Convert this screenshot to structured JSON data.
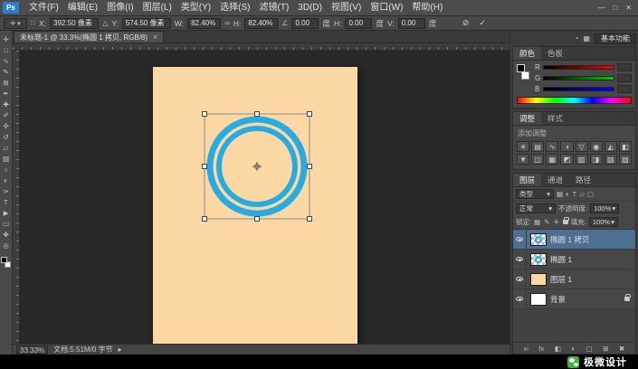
{
  "ui": {
    "caret": "▾"
  },
  "titlebar": {
    "logo": "Ps",
    "menus": [
      "文件(F)",
      "编辑(E)",
      "图像(I)",
      "图层(L)",
      "类型(Y)",
      "选择(S)",
      "滤镜(T)",
      "3D(D)",
      "视图(V)",
      "窗口(W)",
      "帮助(H)"
    ],
    "window_controls": {
      "minimize": "—",
      "restore": "□",
      "close": "✕"
    }
  },
  "options": {
    "preset_glyph": "✛",
    "ref_glyph": "∷",
    "x_label": "X:",
    "x_value": "392.50 像素",
    "delta_glyph": "△",
    "y_label": "Y:",
    "y_value": "574.50 像素",
    "w_label": "W:",
    "w_value": "82.40%",
    "link_glyph": "∞",
    "h_label": "H:",
    "h_value": "82.40%",
    "angle_glyph": "∠",
    "angle_value": "0.00",
    "deg_unit": "度",
    "hskew_label": "H:",
    "hskew_value": "0.00",
    "vskew_label": "V:",
    "vskew_value": "0.00",
    "cancel_glyph": "⊘",
    "commit_glyph": "✓"
  },
  "doc_tab": {
    "title": "未标题-1 @ 33.3%(椭圆 1 拷贝, RGB/8)",
    "close_glyph": "×"
  },
  "toolbar": {
    "tools": [
      {
        "name": "move",
        "glyph": "✛"
      },
      {
        "name": "marquee",
        "glyph": "□"
      },
      {
        "name": "lasso",
        "glyph": "∿"
      },
      {
        "name": "quick-select",
        "glyph": "✎"
      },
      {
        "name": "crop",
        "glyph": "⊞"
      },
      {
        "name": "eyedropper",
        "glyph": "✒"
      },
      {
        "name": "healing",
        "glyph": "✚"
      },
      {
        "name": "brush",
        "glyph": "✐"
      },
      {
        "name": "clone-stamp",
        "glyph": "✣"
      },
      {
        "name": "history-brush",
        "glyph": "↺"
      },
      {
        "name": "eraser",
        "glyph": "▱"
      },
      {
        "name": "gradient",
        "glyph": "▨"
      },
      {
        "name": "blur",
        "glyph": "○"
      },
      {
        "name": "dodge",
        "glyph": "◐"
      },
      {
        "name": "pen",
        "glyph": "✑"
      },
      {
        "name": "type",
        "glyph": "T"
      },
      {
        "name": "path-select",
        "glyph": "▶"
      },
      {
        "name": "shape",
        "glyph": "▭"
      },
      {
        "name": "hand",
        "glyph": "✥"
      },
      {
        "name": "zoom",
        "glyph": "◎"
      }
    ]
  },
  "canvas": {
    "doc_color": "#fcd8a4",
    "ring_color": "#29abe2",
    "handle_color": "#ffffff",
    "bounding_box_color": "#8a8a8a"
  },
  "workspace": {
    "icons": [
      "◔",
      "▦"
    ],
    "label": "基本功能"
  },
  "color_panel": {
    "tabs": [
      "颜色",
      "色板"
    ],
    "channels": [
      "R",
      "G",
      "B"
    ]
  },
  "adjustments_panel": {
    "tabs": [
      "调整",
      "样式"
    ],
    "add_label": "添加调整",
    "icons": [
      "☀",
      "▤",
      "∿",
      "◑",
      "▽",
      "◉",
      "◭",
      "◧",
      "▼",
      "◫",
      "▦",
      "◩",
      "▥",
      "◨",
      "▧",
      "▨"
    ]
  },
  "layers_panel": {
    "tabs": [
      "图层",
      "通道",
      "路径"
    ],
    "filter_label": "类型",
    "filter_icons": [
      "▦",
      "◐",
      "T",
      "▱",
      "▢"
    ],
    "blend_mode": "正常",
    "opacity_label": "不透明度:",
    "opacity_value": "100%",
    "lock_label": "锁定:",
    "lock_icons": [
      "▦",
      "✎",
      "✛"
    ],
    "fill_label": "填充:",
    "fill_value": "100%",
    "layers": [
      {
        "name": "椭圆 1 拷贝",
        "selected": true
      },
      {
        "name": "椭圆 1",
        "selected": false
      },
      {
        "name": "图层 1",
        "selected": false
      },
      {
        "name": "背景",
        "selected": false,
        "locked": true
      }
    ],
    "footer_icons": [
      "∞",
      "fx",
      "◧",
      "◐",
      "▢",
      "⊞",
      "✖"
    ]
  },
  "statusbar": {
    "zoom": "33.33%",
    "doc_info": "文档:5.51M/0 字节",
    "arrow": "▸"
  },
  "footer": {
    "brand": "极微设计"
  }
}
